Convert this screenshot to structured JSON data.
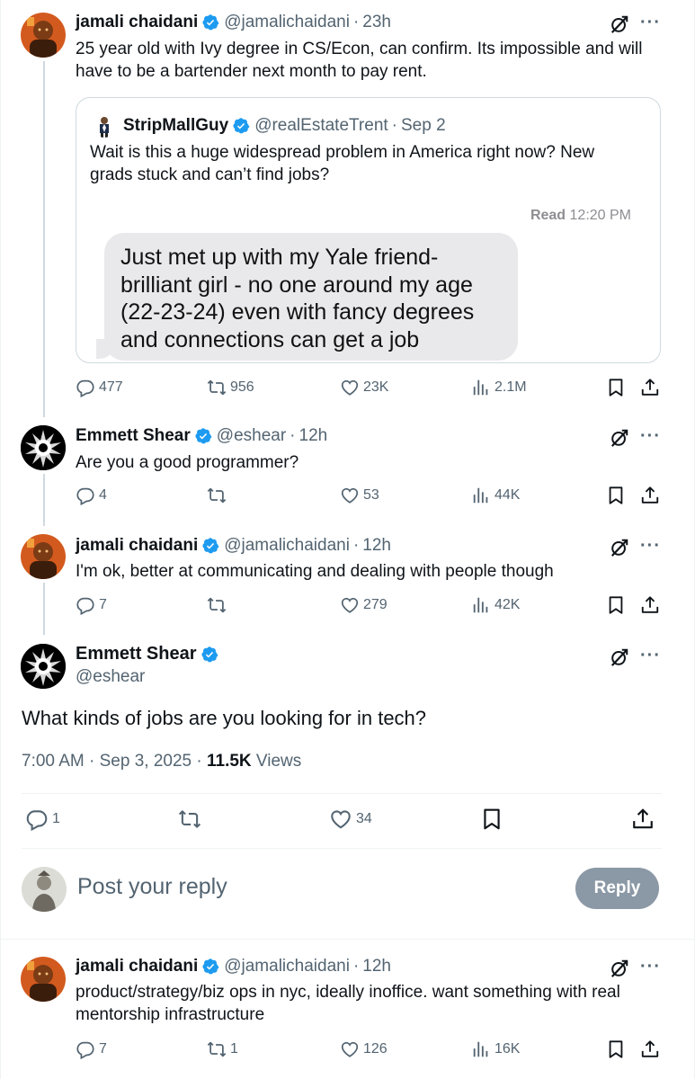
{
  "colors": {
    "accent": "#1d9bf0",
    "muted": "#536471",
    "bubble": "#e9e9eb",
    "reply_button": "#8b98a5"
  },
  "icons": [
    "verified-badge-icon",
    "grok-icon",
    "more-icon",
    "reply-icon",
    "retweet-icon",
    "like-icon",
    "views-icon",
    "bookmark-icon",
    "share-icon"
  ],
  "tweets": [
    {
      "name": "jamali chaidani",
      "handle": "@jamalichaidani",
      "time": "23h",
      "text": "25 year old with Ivy degree in CS/Econ, can confirm. Its impossible and will have to be a bartender next month to pay rent.",
      "quote": {
        "name": "StripMallGuy",
        "handle": "@realEstateTrent",
        "time": "Sep 2",
        "text": "Wait is this a huge widespread problem in America right now? New grads stuck and can’t find jobs?",
        "read_label": "Read",
        "read_time": "12:20 PM",
        "bubble": "Just met up with my Yale friend- brilliant girl - no one around my age (22-23-24) even with fancy degrees and connections can get a job"
      },
      "stats": {
        "replies": "477",
        "retweets": "956",
        "likes": "23K",
        "views": "2.1M"
      }
    },
    {
      "name": "Emmett Shear",
      "handle": "@eshear",
      "time": "12h",
      "text": "Are you a good programmer?",
      "stats": {
        "replies": "4",
        "retweets": "",
        "likes": "53",
        "views": "44K"
      }
    },
    {
      "name": "jamali chaidani",
      "handle": "@jamalichaidani",
      "time": "12h",
      "text": "I'm ok, better at communicating and dealing with people though",
      "stats": {
        "replies": "7",
        "retweets": "",
        "likes": "279",
        "views": "42K"
      }
    },
    {
      "name": "jamali chaidani",
      "handle": "@jamalichaidani",
      "time": "12h",
      "text": "product/strategy/biz ops in nyc, ideally inoffice. want something with real mentorship infrastructure",
      "stats": {
        "replies": "7",
        "retweets": "1",
        "likes": "126",
        "views": "16K"
      }
    }
  ],
  "main_tweet": {
    "name": "Emmett Shear",
    "handle": "@eshear",
    "text": "What kinds of jobs are you looking for in tech?",
    "time": "7:00 AM",
    "date": "Sep 3, 2025",
    "views_count": "11.5K",
    "views_label": "Views",
    "stats": {
      "replies": "1",
      "retweets": "",
      "likes": "34"
    }
  },
  "composer": {
    "placeholder": "Post your reply",
    "button": "Reply"
  }
}
